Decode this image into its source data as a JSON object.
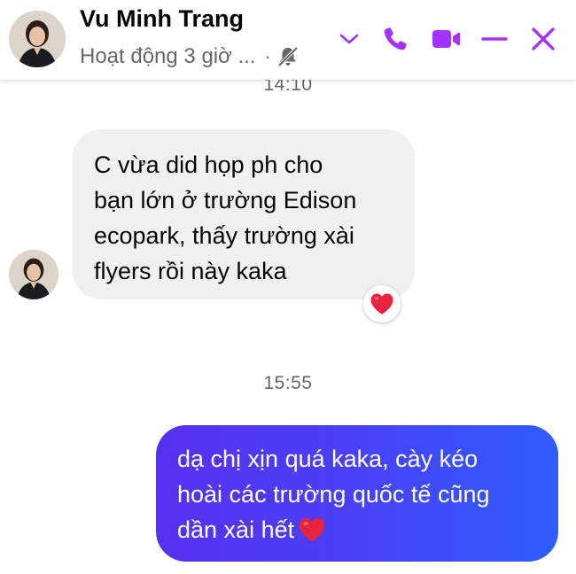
{
  "header": {
    "contact_name": "Vu Minh Trang",
    "status": "Hoạt động 3 giờ ...",
    "status_separator": "·",
    "accent_color": "#a033ff"
  },
  "icons": {
    "header": [
      "avatar",
      "muted-bell-icon",
      "chevron-down-icon",
      "phone-icon",
      "video-call-icon",
      "minimize-icon",
      "close-icon"
    ],
    "reaction": "heart-icon"
  },
  "conversation": {
    "timestamps": [
      "14:10",
      "15:55"
    ],
    "incoming": {
      "text": "C vừa did họp ph cho bạn lớn ở trường Edison ecopark, thấy trường xài flyers rồi này kaka",
      "lines": [
        "C vừa did họp ph cho",
        "bạn lớn ở trường Edison",
        "ecopark, thấy trường xài",
        "flyers rồi này kaka"
      ],
      "reaction": "❤"
    },
    "outgoing": {
      "text": "dạ chị xịn quá kaka, cày kéo hoài các trường quốc tế cũng dần xài hết ❤",
      "lines": [
        "dạ chị xịn quá kaka, cày kéo",
        "hoài các trường quốc tế cũng",
        "dần xài hết"
      ],
      "bubble_gradient": [
        "#5630f0",
        "#2f5dfb"
      ]
    }
  }
}
